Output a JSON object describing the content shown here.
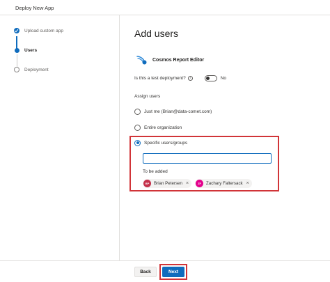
{
  "window": {
    "title": "Deploy New App"
  },
  "steps": [
    {
      "label": "Upload custom app",
      "state": "done"
    },
    {
      "label": "Users",
      "state": "current"
    },
    {
      "label": "Deployment",
      "state": "todo"
    }
  ],
  "main": {
    "title": "Add users",
    "app_name": "Cosmos Report Editor",
    "test_deployment": {
      "label": "Is this a test deployment?",
      "value": "No",
      "info_icon": "info-icon"
    },
    "assign_label": "Assign users",
    "options": [
      {
        "label": "Just me (Brian@data-comet.com)",
        "checked": false
      },
      {
        "label": "Entire organization",
        "checked": false
      },
      {
        "label": "Specific users/groups",
        "checked": true
      }
    ],
    "picker": {
      "value": "",
      "placeholder": ""
    },
    "to_be_added_label": "To be added",
    "users": [
      {
        "initials": "BP",
        "name": "Brian Petersen",
        "color": "#c4314b"
      },
      {
        "initials": "ZF",
        "name": "Zachary Faltersack",
        "color": "#e3008c"
      }
    ]
  },
  "footer": {
    "back_label": "Back",
    "next_label": "Next"
  },
  "colors": {
    "accent": "#0f6cbd",
    "highlight": "#d13438"
  }
}
